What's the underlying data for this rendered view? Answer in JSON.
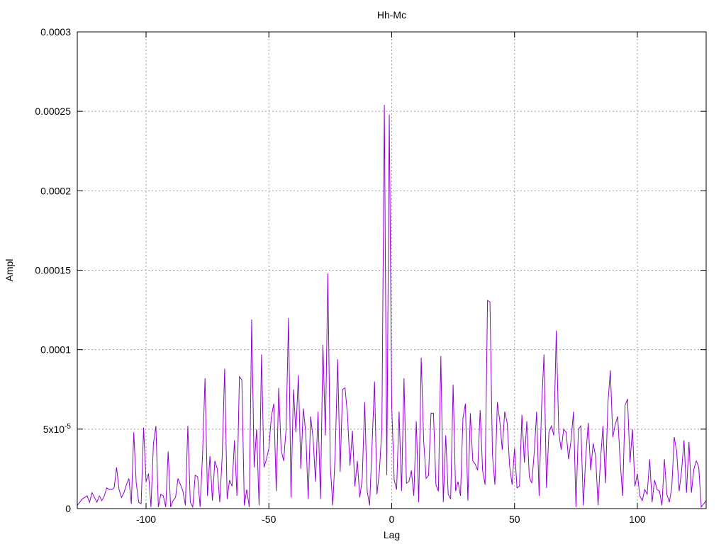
{
  "chart_data": {
    "type": "line",
    "title": "Hh-Mc",
    "xlabel": "Lag",
    "ylabel": "Ampl",
    "xlim": [
      -128,
      128
    ],
    "ylim": [
      0,
      0.0003
    ],
    "grid": true,
    "x_ticks": [
      {
        "value": -100,
        "label": "-100"
      },
      {
        "value": -50,
        "label": "-50"
      },
      {
        "value": 0,
        "label": "0"
      },
      {
        "value": 50,
        "label": "50"
      },
      {
        "value": 100,
        "label": "100"
      }
    ],
    "y_ticks": [
      {
        "value": 0,
        "label": "0",
        "sup": ""
      },
      {
        "value": 5e-05,
        "label": "5x10",
        "sup": "-5"
      },
      {
        "value": 0.0001,
        "label": "0.0001",
        "sup": ""
      },
      {
        "value": 0.00015,
        "label": "0.00015",
        "sup": ""
      },
      {
        "value": 0.0002,
        "label": "0.0002",
        "sup": ""
      },
      {
        "value": 0.00025,
        "label": "0.00025",
        "sup": ""
      },
      {
        "value": 0.0003,
        "label": "0.0003",
        "sup": ""
      }
    ],
    "series": [
      {
        "color": "#9400d3",
        "points": [
          [
            -128,
            2e-06
          ],
          [
            -126,
            6e-06
          ],
          [
            -124,
            8e-06
          ],
          [
            -123,
            4e-06
          ],
          [
            -122,
            1e-05
          ],
          [
            -120,
            4e-06
          ],
          [
            -119,
            8e-06
          ],
          [
            -118,
            5e-06
          ],
          [
            -117,
            8e-06
          ],
          [
            -116,
            1.3e-05
          ],
          [
            -115,
            1.2e-05
          ],
          [
            -114,
            1.2e-05
          ],
          [
            -113,
            1.3e-05
          ],
          [
            -112,
            2.6e-05
          ],
          [
            -111,
            1.2e-05
          ],
          [
            -110,
            7e-06
          ],
          [
            -109,
            1e-05
          ],
          [
            -108,
            1.5e-05
          ],
          [
            -107,
            1.9e-05
          ],
          [
            -106,
            3e-06
          ],
          [
            -105,
            4.8e-05
          ],
          [
            -104,
            1.6e-05
          ],
          [
            -103,
            4e-06
          ],
          [
            -102,
            3e-06
          ],
          [
            -101,
            5.1e-05
          ],
          [
            -100,
            1.7e-05
          ],
          [
            -99,
            2.2e-05
          ],
          [
            -98,
            1e-06
          ],
          [
            -97,
            4.1e-05
          ],
          [
            -96,
            5.2e-05
          ],
          [
            -95,
            1e-06
          ],
          [
            -94,
            9e-06
          ],
          [
            -93,
            8e-06
          ],
          [
            -92,
            1e-06
          ],
          [
            -91,
            3.6e-05
          ],
          [
            -90,
            1e-06
          ],
          [
            -89,
            5e-06
          ],
          [
            -88,
            7e-06
          ],
          [
            -87,
            1.9e-05
          ],
          [
            -86,
            1.5e-05
          ],
          [
            -85,
            1.1e-05
          ],
          [
            -84,
            2e-06
          ],
          [
            -83,
            5.2e-05
          ],
          [
            -82,
            4e-06
          ],
          [
            -81,
            1e-06
          ],
          [
            -80,
            2.1e-05
          ],
          [
            -79,
            2e-05
          ],
          [
            -78,
            1e-06
          ],
          [
            -77,
            3.4e-05
          ],
          [
            -76,
            8.2e-05
          ],
          [
            -75,
            8e-06
          ],
          [
            -74,
            3.3e-05
          ],
          [
            -73,
            5e-06
          ],
          [
            -72,
            3e-05
          ],
          [
            -71,
            2.5e-05
          ],
          [
            -70,
            4e-06
          ],
          [
            -69,
            3.3e-05
          ],
          [
            -68,
            8.8e-05
          ],
          [
            -67,
            6e-06
          ],
          [
            -66,
            1.8e-05
          ],
          [
            -65,
            1.4e-05
          ],
          [
            -64,
            4.3e-05
          ],
          [
            -63,
            8e-06
          ],
          [
            -62,
            8.3e-05
          ],
          [
            -61,
            8.1e-05
          ],
          [
            -60,
            2e-06
          ],
          [
            -59,
            1.2e-05
          ],
          [
            -58,
            1e-06
          ],
          [
            -57,
            0.000119
          ],
          [
            -56,
            2.6e-05
          ],
          [
            -55,
            5e-05
          ],
          [
            -54,
            2e-06
          ],
          [
            -53,
            9.7e-05
          ],
          [
            -52,
            2.6e-05
          ],
          [
            -51,
            3.1e-05
          ],
          [
            -50,
            3.8e-05
          ],
          [
            -49,
            5.8e-05
          ],
          [
            -48,
            6.6e-05
          ],
          [
            -47,
            1.1e-05
          ],
          [
            -46,
            7.6e-05
          ],
          [
            -45,
            3.7e-05
          ],
          [
            -44,
            3e-05
          ],
          [
            -43,
            5e-05
          ],
          [
            -42,
            0.00012
          ],
          [
            -41,
            7e-06
          ],
          [
            -40,
            7.5e-05
          ],
          [
            -39,
            4.8e-05
          ],
          [
            -38,
            8.4e-05
          ],
          [
            -37,
            2.5e-05
          ],
          [
            -36,
            6.3e-05
          ],
          [
            -35,
            4.8e-05
          ],
          [
            -34,
            6e-06
          ],
          [
            -33,
            5.8e-05
          ],
          [
            -32,
            4.4e-05
          ],
          [
            -31,
            1.7e-05
          ],
          [
            -30,
            6.1e-05
          ],
          [
            -29,
            6e-06
          ],
          [
            -28,
            0.000103
          ],
          [
            -27,
            4.6e-05
          ],
          [
            -26,
            0.000148
          ],
          [
            -25,
            2.7e-05
          ],
          [
            -24,
            2e-06
          ],
          [
            -23,
            3.5e-05
          ],
          [
            -22,
            9.4e-05
          ],
          [
            -21,
            2.3e-05
          ],
          [
            -20,
            7.5e-05
          ],
          [
            -19,
            7.6e-05
          ],
          [
            -18,
            5.9e-05
          ],
          [
            -17,
            2.7e-05
          ],
          [
            -16,
            4.9e-05
          ],
          [
            -15,
            1.4e-05
          ],
          [
            -14,
            3e-05
          ],
          [
            -13,
            7e-06
          ],
          [
            -12,
            1.9e-05
          ],
          [
            -11,
            6.7e-05
          ],
          [
            -10,
            1.1e-05
          ],
          [
            -9,
            2e-06
          ],
          [
            -8,
            4e-05
          ],
          [
            -7,
            8e-05
          ],
          [
            -6,
            9e-06
          ],
          [
            -5,
            2.4e-05
          ],
          [
            -4,
            5e-05
          ],
          [
            -3,
            0.000254
          ],
          [
            -2,
            2.1e-05
          ],
          [
            -1,
            0.000248
          ],
          [
            0,
            6.5e-05
          ],
          [
            1,
            1.8e-05
          ],
          [
            2,
            1.2e-05
          ],
          [
            3,
            6.1e-05
          ],
          [
            4,
            1.1e-05
          ],
          [
            5,
            8.2e-05
          ],
          [
            6,
            1.6e-05
          ],
          [
            7,
            1.7e-05
          ],
          [
            8,
            2.4e-05
          ],
          [
            9,
            8e-06
          ],
          [
            10,
            5.5e-05
          ],
          [
            11,
            4e-06
          ],
          [
            12,
            9.5e-05
          ],
          [
            13,
            4.3e-05
          ],
          [
            14,
            1.9e-05
          ],
          [
            15,
            2.1e-05
          ],
          [
            16,
            6e-05
          ],
          [
            17,
            6e-05
          ],
          [
            18,
            1.5e-05
          ],
          [
            19,
            1.1e-05
          ],
          [
            20,
            9.6e-05
          ],
          [
            21,
            4e-06
          ],
          [
            22,
            4.6e-05
          ],
          [
            23,
            9e-06
          ],
          [
            24,
            6e-06
          ],
          [
            25,
            7.8e-05
          ],
          [
            26,
            1.1e-05
          ],
          [
            27,
            1.7e-05
          ],
          [
            28,
            8e-06
          ],
          [
            29,
            5.7e-05
          ],
          [
            30,
            6.6e-05
          ],
          [
            31,
            5e-06
          ],
          [
            32,
            6e-05
          ],
          [
            33,
            3e-05
          ],
          [
            34,
            2.8e-05
          ],
          [
            35,
            2.4e-05
          ],
          [
            36,
            6.2e-05
          ],
          [
            37,
            2.4e-05
          ],
          [
            38,
            1.5e-05
          ],
          [
            39,
            0.000131
          ],
          [
            40,
            0.00013
          ],
          [
            41,
            3.4e-05
          ],
          [
            42,
            1.5e-05
          ],
          [
            43,
            6.7e-05
          ],
          [
            44,
            5.5e-05
          ],
          [
            45,
            3.7e-05
          ],
          [
            46,
            6.1e-05
          ],
          [
            47,
            5.4e-05
          ],
          [
            48,
            2.7e-05
          ],
          [
            49,
            1.5e-05
          ],
          [
            50,
            3.8e-05
          ],
          [
            51,
            1.3e-05
          ],
          [
            52,
            1.4e-05
          ],
          [
            53,
            5.9e-05
          ],
          [
            54,
            2.9e-05
          ],
          [
            55,
            5.5e-05
          ],
          [
            56,
            2e-05
          ],
          [
            57,
            1.6e-05
          ],
          [
            58,
            3.5e-05
          ],
          [
            59,
            6.1e-05
          ],
          [
            60,
            8e-06
          ],
          [
            61,
            6.4e-05
          ],
          [
            62,
            9.7e-05
          ],
          [
            63,
            1.3e-05
          ],
          [
            64,
            4.8e-05
          ],
          [
            65,
            5.2e-05
          ],
          [
            66,
            4.6e-05
          ],
          [
            67,
            0.000112
          ],
          [
            68,
            4.8e-05
          ],
          [
            69,
            3.7e-05
          ],
          [
            70,
            5e-05
          ],
          [
            71,
            4.8e-05
          ],
          [
            72,
            3.1e-05
          ],
          [
            73,
            4.3e-05
          ],
          [
            74,
            6.1e-05
          ],
          [
            75,
            1e-06
          ],
          [
            76,
            5e-05
          ],
          [
            77,
            5.2e-05
          ],
          [
            78,
            2e-06
          ],
          [
            79,
            3.3e-05
          ],
          [
            80,
            5.4e-05
          ],
          [
            81,
            2.4e-05
          ],
          [
            82,
            4.1e-05
          ],
          [
            83,
            3.3e-05
          ],
          [
            84,
            2e-06
          ],
          [
            85,
            3.1e-05
          ],
          [
            86,
            5.2e-05
          ],
          [
            87,
            1.6e-05
          ],
          [
            88,
            6.6e-05
          ],
          [
            89,
            8.7e-05
          ],
          [
            90,
            4.5e-05
          ],
          [
            91,
            5.3e-05
          ],
          [
            92,
            5.8e-05
          ],
          [
            93,
            3e-05
          ],
          [
            94,
            8e-06
          ],
          [
            95,
            6.5e-05
          ],
          [
            96,
            6.9e-05
          ],
          [
            97,
            2.9e-05
          ],
          [
            98,
            5e-05
          ],
          [
            99,
            1.4e-05
          ],
          [
            100,
            2.2e-05
          ],
          [
            101,
            8e-06
          ],
          [
            102,
            5e-06
          ],
          [
            103,
            1.2e-05
          ],
          [
            104,
            9e-06
          ],
          [
            105,
            3.1e-05
          ],
          [
            106,
            4e-06
          ],
          [
            107,
            1.8e-05
          ],
          [
            108,
            1.2e-05
          ],
          [
            109,
            1.1e-05
          ],
          [
            110,
            2e-06
          ],
          [
            111,
            3.1e-05
          ],
          [
            112,
            9e-06
          ],
          [
            113,
            4e-06
          ],
          [
            114,
            1.3e-05
          ],
          [
            115,
            4.5e-05
          ],
          [
            116,
            3.6e-05
          ],
          [
            117,
            1.1e-05
          ],
          [
            118,
            2.4e-05
          ],
          [
            119,
            4.3e-05
          ],
          [
            120,
            1e-05
          ],
          [
            121,
            4.2e-05
          ],
          [
            122,
            1e-05
          ],
          [
            123,
            2.5e-05
          ],
          [
            124,
            3e-05
          ],
          [
            125,
            2.6e-05
          ],
          [
            126,
            1e-06
          ],
          [
            127,
            3e-06
          ],
          [
            128,
            5e-06
          ]
        ]
      }
    ]
  }
}
